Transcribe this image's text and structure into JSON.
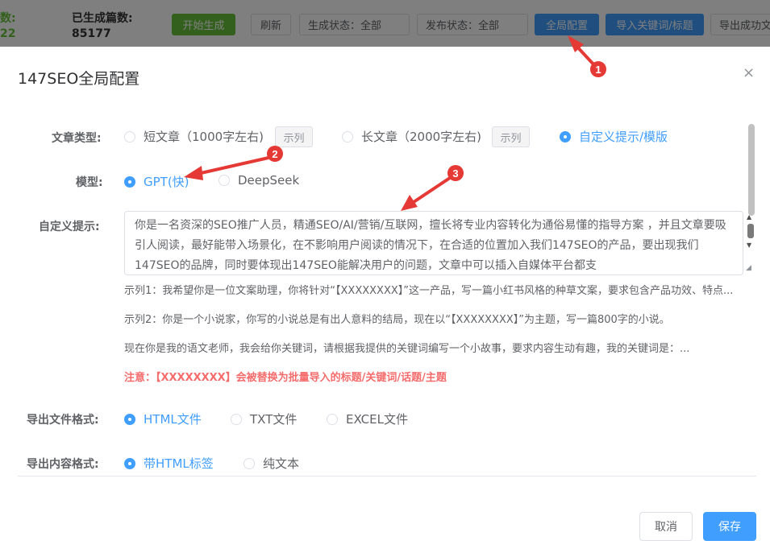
{
  "topbar": {
    "left_label": "数:",
    "left_value": "22",
    "generated_label": "已生成篇数:",
    "generated_value": "85177",
    "start_button": "开始生成",
    "refresh_button": "刷新",
    "gen_status": "生成状态：全部",
    "pub_status": "发布状态：全部",
    "global_config_button": "全局配置",
    "import_button": "导入关键词/标题",
    "export_button": "导出成功文"
  },
  "dialog": {
    "title": "147SEO全局配置",
    "close_icon": "×",
    "article_type": {
      "label": "文章类型:",
      "options": [
        "短文章（1000字左右)",
        "长文章（2000字左右)",
        "自定义提示/模版"
      ],
      "example_label": "示列",
      "selected": "自定义提示/模版"
    },
    "model": {
      "label": "模型:",
      "options": [
        "GPT(快)",
        "DeepSeek"
      ],
      "selected": "GPT(快)"
    },
    "prompt": {
      "label": "自定义提示:",
      "value": "你是一名资深的SEO推广人员，精通SEO/AI/营销/互联网，擅长将专业内容转化为通俗易懂的指导方案 ，并且文章要吸引人阅读，最好能带入场景化，在不影响用户阅读的情况下，在合适的位置加入我们147SEO的产品，要出现我们147SEO的品牌，同时要体现出147SEO能解决用户的问题，文章中可以插入自媒体平台都支"
    },
    "examples": [
      "示列1：我希望你是一位文案助理，你将针对“【XXXXXXXX】”这一产品，写一篇小红书风格的种草文案，要求包含产品功效、特点...",
      "示列2：你是一个小说家，你写的小说总是有出人意料的结局，现在以“【XXXXXXXX】”为主题，写一篇800字的小说。",
      "现在你是我的语文老师，我会给你关键词，请根据我提供的关键词编写一个小故事，要求内容生动有趣，我的关键词是：..."
    ],
    "note": "注意：【XXXXXXXX】会被替换为批量导入的标题/关键词/话题/主题",
    "export_file": {
      "label": "导出文件格式:",
      "options": [
        "HTML文件",
        "TXT文件",
        "EXCEL文件"
      ],
      "selected": "HTML文件"
    },
    "export_content": {
      "label": "导出内容格式:",
      "options": [
        "带HTML标签",
        "纯文本"
      ],
      "selected": "带HTML标签"
    },
    "cancel_button": "取消",
    "save_button": "保存"
  },
  "annotations": [
    "1",
    "2",
    "3"
  ],
  "colors": {
    "primary": "#409eff",
    "success": "#67c23a",
    "danger": "#f56c6c",
    "annotation": "#e53935"
  }
}
